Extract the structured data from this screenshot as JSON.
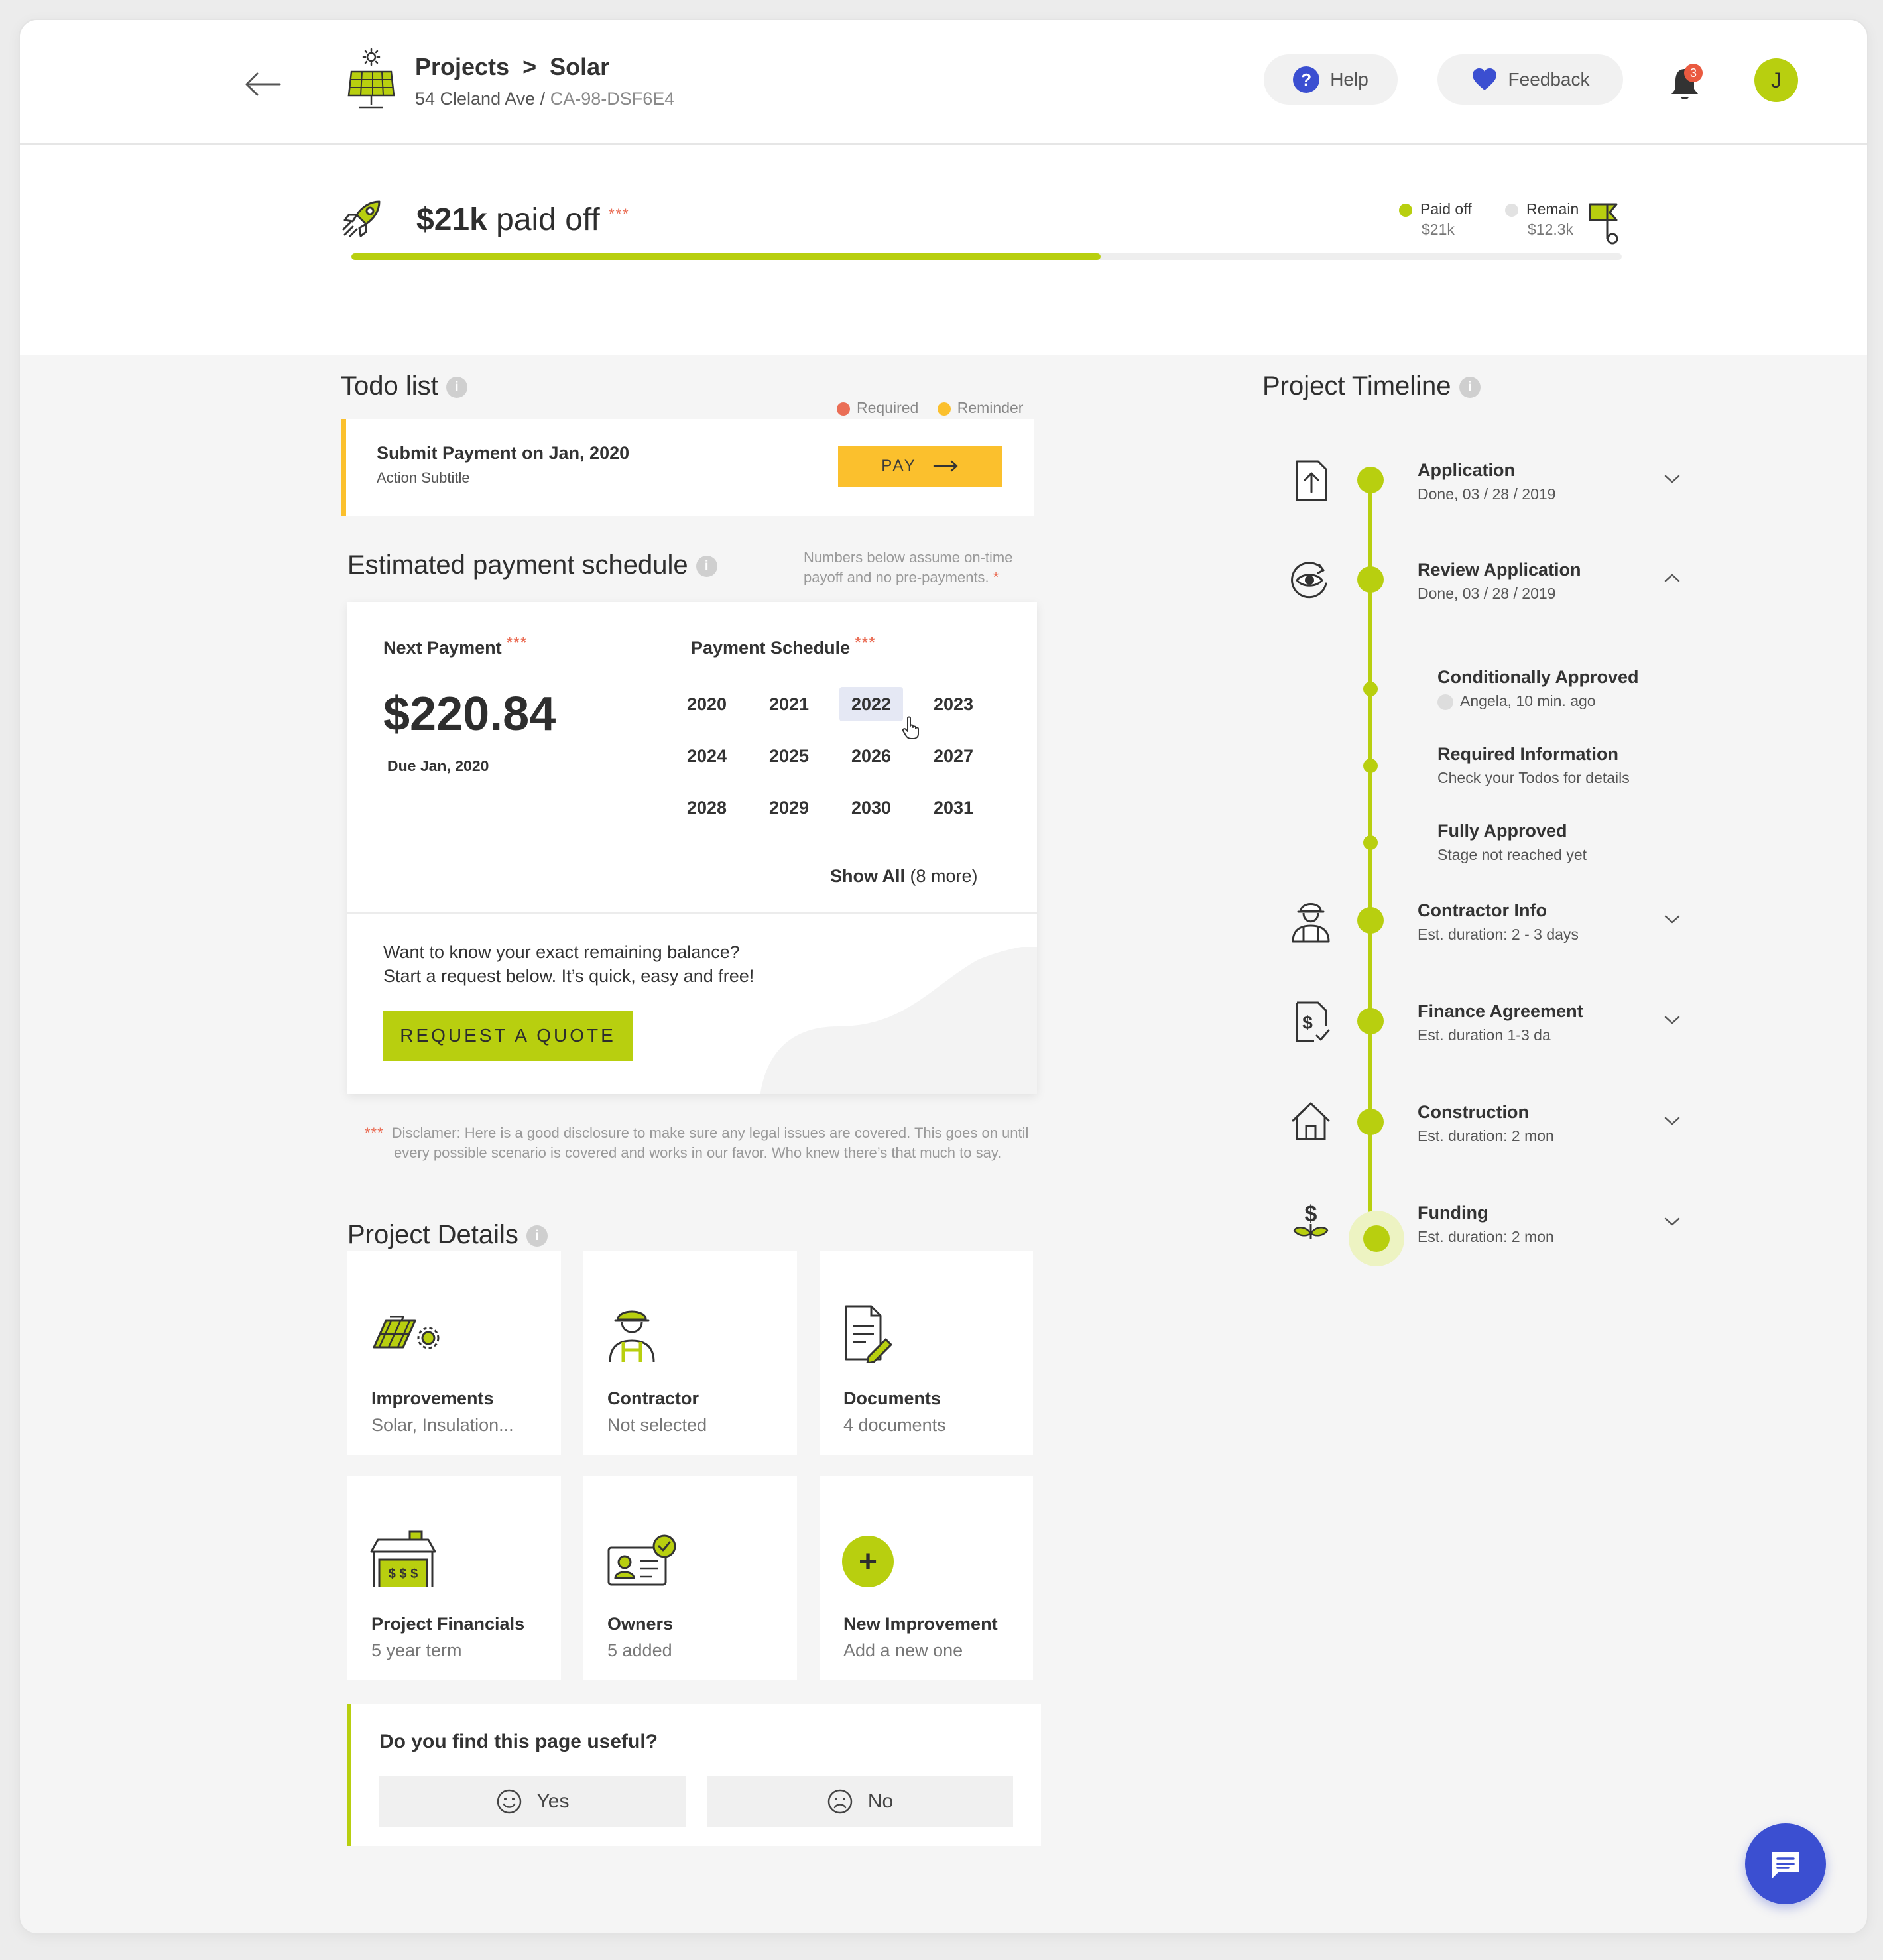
{
  "colors": {
    "accent": "#b8cf0f",
    "warning": "#fbc02d",
    "required": "#ea6e56",
    "brand_blue": "#3b4fd1"
  },
  "header": {
    "breadcrumb_root": "Projects",
    "breadcrumb_sep": ">",
    "breadcrumb_current": "Solar",
    "address": "54 Cleland Ave",
    "slash": "/",
    "project_code": "CA-98-DSF6E4",
    "help_label": "Help",
    "feedback_label": "Feedback",
    "notification_count": "3",
    "avatar_initial": "J"
  },
  "progress": {
    "amount": "$21k",
    "label": "paid off",
    "stars": "***",
    "paid_label": "Paid off",
    "paid_value": "$21k",
    "remain_label": "Remain",
    "remain_value": "$12.3k",
    "fraction": 0.59
  },
  "todo": {
    "title": "Todo list",
    "info": "i",
    "required_label": "Required",
    "reminder_label": "Reminder",
    "item_title": "Submit Payment on Jan, 2020",
    "item_subtitle": "Action Subtitle",
    "pay_label": "PAY"
  },
  "schedule": {
    "title": "Estimated payment schedule",
    "info": "i",
    "note": "Numbers below assume on-time payoff and no pre-payments.",
    "note_star": "*",
    "next_label": "Next Payment",
    "stars": "***",
    "amount": "$220.84",
    "due": "Due Jan, 2020",
    "schedule_label": "Payment Schedule",
    "years": [
      "2020",
      "2021",
      "2022",
      "2023",
      "2024",
      "2025",
      "2026",
      "2027",
      "2028",
      "2029",
      "2030",
      "2031"
    ],
    "selected_year": "2022",
    "show_all": "Show All",
    "more": "(8 more)",
    "quote_line1": "Want to know your exact remaining balance?",
    "quote_line2": "Start a request below. It’s quick, easy and free!",
    "quote_button": "REQUEST A QUOTE"
  },
  "disclaimer": {
    "stars": "***",
    "text": "Disclamer: Here is a good disclosure to make sure any legal issues are covered. This goes on until every possible scenario is covered and works in our favor. Who knew there’s that much to say."
  },
  "details": {
    "title": "Project Details",
    "info": "i",
    "tiles": [
      {
        "title": "Improvements",
        "sub": "Solar, Insulation...",
        "icon": "solar-panel-gear-icon"
      },
      {
        "title": "Contractor",
        "sub": "Not selected",
        "icon": "contractor-icon"
      },
      {
        "title": "Documents",
        "sub": "4 documents",
        "icon": "document-pen-icon"
      },
      {
        "title": "Project Financials",
        "sub": "5 year term",
        "icon": "financials-house-icon"
      },
      {
        "title": "Owners",
        "sub": "5 added",
        "icon": "id-card-check-icon"
      },
      {
        "title": "New Improvement",
        "sub": "Add a new one",
        "icon": "plus-icon"
      }
    ],
    "plus": "+"
  },
  "useful": {
    "question": "Do you find this page useful?",
    "yes": "Yes",
    "no": "No"
  },
  "timeline": {
    "title": "Project Timeline",
    "info": "i",
    "stages": [
      {
        "title": "Application",
        "meta": "Done, 03 / 28 / 2019",
        "icon": "upload-document-icon",
        "expanded": false
      },
      {
        "title": "Review Application",
        "meta": "Done, 03 / 28 / 2019",
        "icon": "eye-review-icon",
        "expanded": true
      },
      {
        "title": "Contractor Info",
        "meta": "Est. duration: 2 - 3 days",
        "icon": "worker-icon",
        "expanded": false
      },
      {
        "title": "Finance Agreement",
        "meta": "Est. duration 1-3 da",
        "icon": "dollar-document-icon",
        "expanded": false
      },
      {
        "title": "Construction",
        "meta": "Est. duration: 2 mon",
        "icon": "house-icon",
        "expanded": false
      },
      {
        "title": "Funding",
        "meta": "Est. duration: 2 mon",
        "icon": "dollar-plant-icon",
        "expanded": false
      }
    ],
    "substeps": [
      {
        "title": "Conditionally Approved",
        "meta": "Angela, 10 min. ago"
      },
      {
        "title": "Required Information",
        "meta": "Check your Todos for details"
      },
      {
        "title": "Fully Approved",
        "meta": "Stage not reached yet"
      }
    ]
  }
}
